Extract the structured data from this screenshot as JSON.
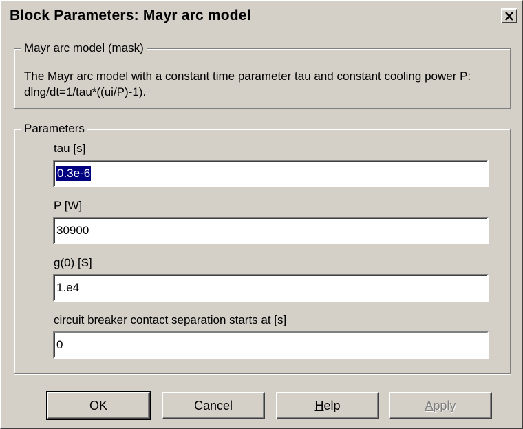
{
  "window": {
    "title": "Block Parameters: Mayr arc model"
  },
  "mask_group": {
    "legend": "Mayr arc model (mask)",
    "description": "The Mayr arc model with a constant time parameter tau and constant cooling power P: dlng/dt=1/tau*((ui/P)-1)."
  },
  "parameters": {
    "legend": "Parameters",
    "fields": [
      {
        "label": "tau [s]",
        "value": "0.3e-6",
        "selected": true
      },
      {
        "label": "P [W]",
        "value": "30900"
      },
      {
        "label": "g(0) [S]",
        "value": "1.e4",
        "access_key": "g"
      },
      {
        "label": "circuit breaker contact separation starts at [s]",
        "value": "0"
      }
    ]
  },
  "buttons": {
    "ok": "OK",
    "cancel": "Cancel",
    "help": "Help",
    "apply": "Apply"
  },
  "colors": {
    "dialog_bg": "#d4d0c8",
    "selection": "#000080",
    "disabled_text": "#808080"
  }
}
